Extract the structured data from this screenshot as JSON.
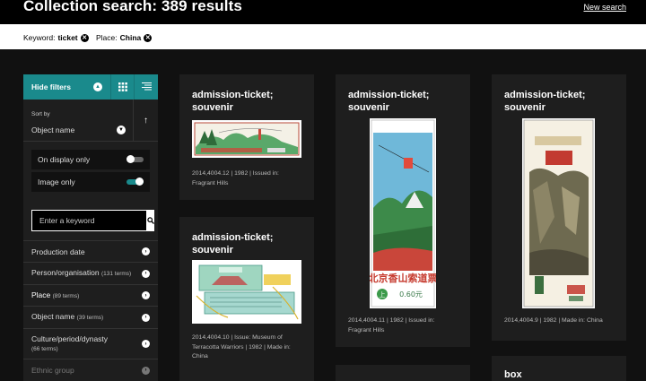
{
  "header": {
    "title": "Collection search: 389 results",
    "new_search": "New search"
  },
  "chips": [
    {
      "key": "Keyword:",
      "value": "ticket"
    },
    {
      "key": "Place:",
      "value": "China"
    }
  ],
  "sidebar": {
    "hide_filters": "Hide filters",
    "sort_by_label": "Sort by",
    "sort_value": "Object name",
    "toggles": [
      {
        "label": "On display only",
        "state": "off"
      },
      {
        "label": "Image only",
        "state": "on"
      }
    ],
    "keyword_placeholder": "Enter a keyword",
    "facets": [
      {
        "label": "Production date",
        "count": ""
      },
      {
        "label": "Person/organisation",
        "count": "(131 terms)"
      },
      {
        "label": "Place",
        "count": "(89 terms)"
      },
      {
        "label": "Object name",
        "count": "(39 terms)"
      },
      {
        "label": "Culture/period/dynasty",
        "count": "(66 terms)"
      },
      {
        "label": "Ethnic group",
        "count": ""
      }
    ]
  },
  "cards": [
    {
      "title": "admission-ticket; souvenir",
      "meta": [
        "2014,4004.12  | 1982  | Issued in:",
        "Fragrant Hills"
      ]
    },
    {
      "title": "admission-ticket; souvenir",
      "meta": [
        "2014,4004.10  | Issue: Museum of",
        "Terracotta Warriors  | 1982  | Made in:",
        "China"
      ]
    },
    {
      "title": "admission-ticket; souvenir",
      "meta": [
        "2014,4004.11  | 1982  | Issued in:",
        "Fragrant Hills"
      ]
    },
    {
      "title": "admission-ticket; souvenir",
      "meta": [
        "2014,4004.9  | 1982  | Made in: China"
      ]
    },
    {
      "title": "box",
      "meta": []
    }
  ],
  "ticket_text": {
    "ticket_vertical_price": "0.60元",
    "ticket_vertical_badge": "上"
  },
  "colors": {
    "accent": "#1a8a8c",
    "card_bg": "#1e1e1e",
    "page_bg": "#000000"
  }
}
